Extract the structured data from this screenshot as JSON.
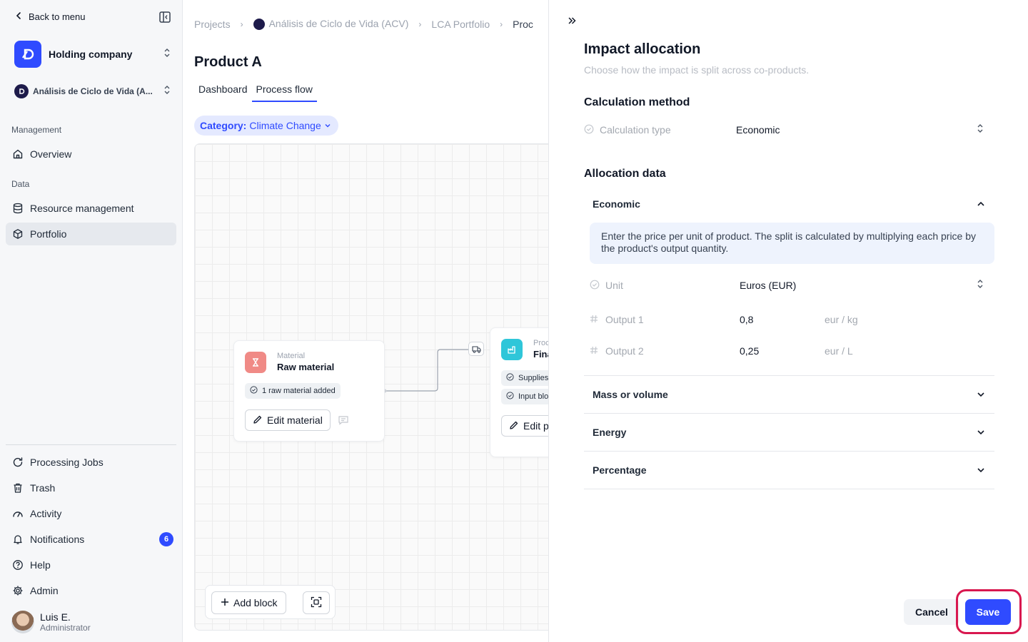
{
  "sidebar": {
    "back_label": "Back to menu",
    "org_name": "Holding company",
    "project_name": "Análisis de Ciclo de Vida (A...",
    "sections": {
      "management": "Management",
      "data": "Data"
    },
    "items": {
      "overview": "Overview",
      "resource_management": "Resource management",
      "portfolio": "Portfolio",
      "processing_jobs": "Processing Jobs",
      "trash": "Trash",
      "activity": "Activity",
      "notifications": "Notifications",
      "help": "Help",
      "admin": "Admin"
    },
    "notifications_count": "6",
    "user": {
      "name": "Luis E.",
      "role": "Administrator"
    }
  },
  "breadcrumb": [
    "Projects",
    "Análisis de Ciclo de Vida (ACV)",
    "LCA Portfolio",
    "Proc"
  ],
  "page": {
    "title": "Product A",
    "tabs": [
      "Dashboard",
      "Process flow"
    ],
    "active_tab": "Process flow",
    "category_label": "Category:",
    "category_value": "Climate Change"
  },
  "canvas": {
    "material_card": {
      "type": "Material",
      "title": "Raw material",
      "pill": "1 raw material added",
      "button": "Edit material"
    },
    "process_card": {
      "type": "Proc",
      "title": "Fina",
      "pill1": "Supplies",
      "pill2": "Input blo",
      "button": "Edit p"
    },
    "toolbar": {
      "add_block": "Add block"
    }
  },
  "panel": {
    "title": "Impact allocation",
    "subtitle": "Choose how the impact is split across co-products.",
    "calc_method_heading": "Calculation method",
    "calc_type_label": "Calculation type",
    "calc_type_value": "Economic",
    "allocation_heading": "Allocation data",
    "sections": {
      "economic": "Economic",
      "mass": "Mass or volume",
      "energy": "Energy",
      "percentage": "Percentage"
    },
    "info_text": "Enter the price per unit of product. The split is calculated by multiplying each price by the product's output quantity.",
    "unit_label": "Unit",
    "unit_value": "Euros (EUR)",
    "outputs": [
      {
        "label": "Output 1",
        "value": "0,8",
        "unit": "eur / kg"
      },
      {
        "label": "Output 2",
        "value": "0,25",
        "unit": "eur / L"
      }
    ],
    "cancel_label": "Cancel",
    "save_label": "Save"
  },
  "colors": {
    "accent": "#2f4bff",
    "highlight_ring": "#d8174f",
    "material": "#f08a86",
    "process": "#2fc6d9"
  }
}
